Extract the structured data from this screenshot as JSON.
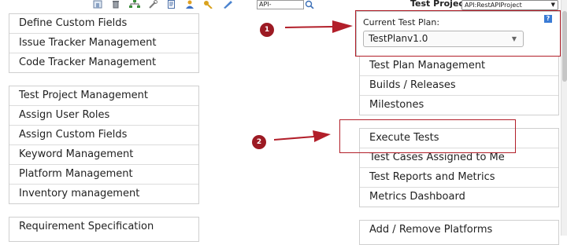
{
  "toolbar": {
    "search_value": "API-",
    "test_project_label": "Test Project",
    "test_project_value": "API:RestAPIProject"
  },
  "left_menu": {
    "group1": [
      "Define Custom Fields",
      "Issue Tracker Management",
      "Code Tracker Management"
    ],
    "group2": [
      "Test Project Management",
      "Assign User Roles",
      "Assign Custom Fields",
      "Keyword Management",
      "Platform Management",
      "Inventory management"
    ],
    "group3": [
      "Requirement Specification"
    ]
  },
  "plan_panel": {
    "caption": "Current Test Plan:",
    "selected": "TestPlanv1.0",
    "help": "?"
  },
  "right_menu": {
    "group1": [
      "Test Plan Management",
      "Builds / Releases",
      "Milestones"
    ],
    "group2": [
      "Execute Tests",
      "Test Cases Assigned to Me",
      "Test Reports and Metrics",
      "Metrics Dashboard"
    ],
    "group3": [
      "Add / Remove Platforms"
    ]
  },
  "annotations": {
    "badge1": "1",
    "badge2": "2",
    "color": "#b21f2a"
  }
}
